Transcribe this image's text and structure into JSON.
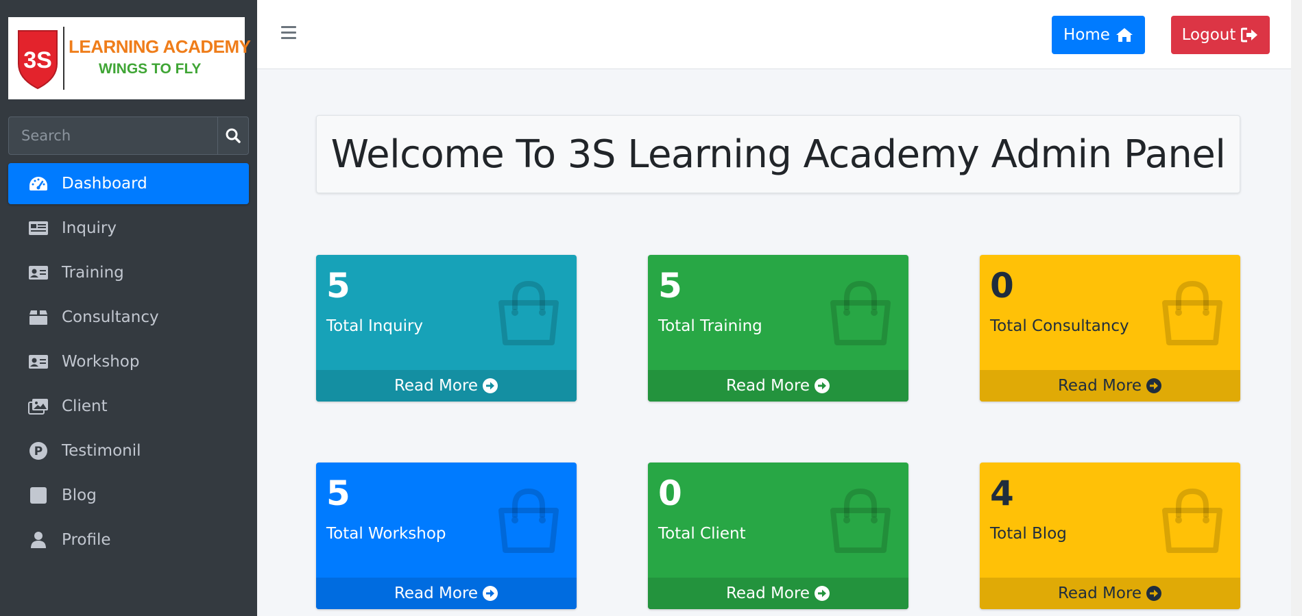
{
  "brand": {
    "logo_text": "3S",
    "name": "LEARNING ACADEMY",
    "tagline": "WINGS TO FLY"
  },
  "search": {
    "placeholder": "Search"
  },
  "sidebar": {
    "items": [
      {
        "label": "Dashboard",
        "icon": "tachometer-icon",
        "active": true
      },
      {
        "label": "Inquiry",
        "icon": "newspaper-icon"
      },
      {
        "label": "Training",
        "icon": "id-card-icon"
      },
      {
        "label": "Consultancy",
        "icon": "box-icon"
      },
      {
        "label": "Workshop",
        "icon": "id-card-icon"
      },
      {
        "label": "Client",
        "icon": "images-icon"
      },
      {
        "label": "Testimonil",
        "icon": "parking-circle-icon"
      },
      {
        "label": "Blog",
        "icon": "square-icon"
      },
      {
        "label": "Profile",
        "icon": "user-icon"
      }
    ]
  },
  "topbar": {
    "home_label": "Home",
    "logout_label": "Logout"
  },
  "welcome": {
    "title": "Welcome To 3S Learning Academy Admin Panel"
  },
  "stats": [
    {
      "count": "5",
      "label": "Total Inquiry",
      "color": "info",
      "link": "Read More"
    },
    {
      "count": "5",
      "label": "Total Training",
      "color": "success",
      "link": "Read More"
    },
    {
      "count": "0",
      "label": "Total Consultancy",
      "color": "warning",
      "link": "Read More"
    },
    {
      "count": "5",
      "label": "Total Workshop",
      "color": "primary",
      "link": "Read More"
    },
    {
      "count": "0",
      "label": "Total Client",
      "color": "success",
      "link": "Read More"
    },
    {
      "count": "4",
      "label": "Total Blog",
      "color": "warning",
      "link": "Read More"
    }
  ],
  "colors": {
    "sidebar_bg": "#343a40",
    "accent_primary": "#007bff",
    "danger": "#dc3545",
    "info": "#17a2b8",
    "success": "#28a745",
    "warning": "#ffc107"
  }
}
